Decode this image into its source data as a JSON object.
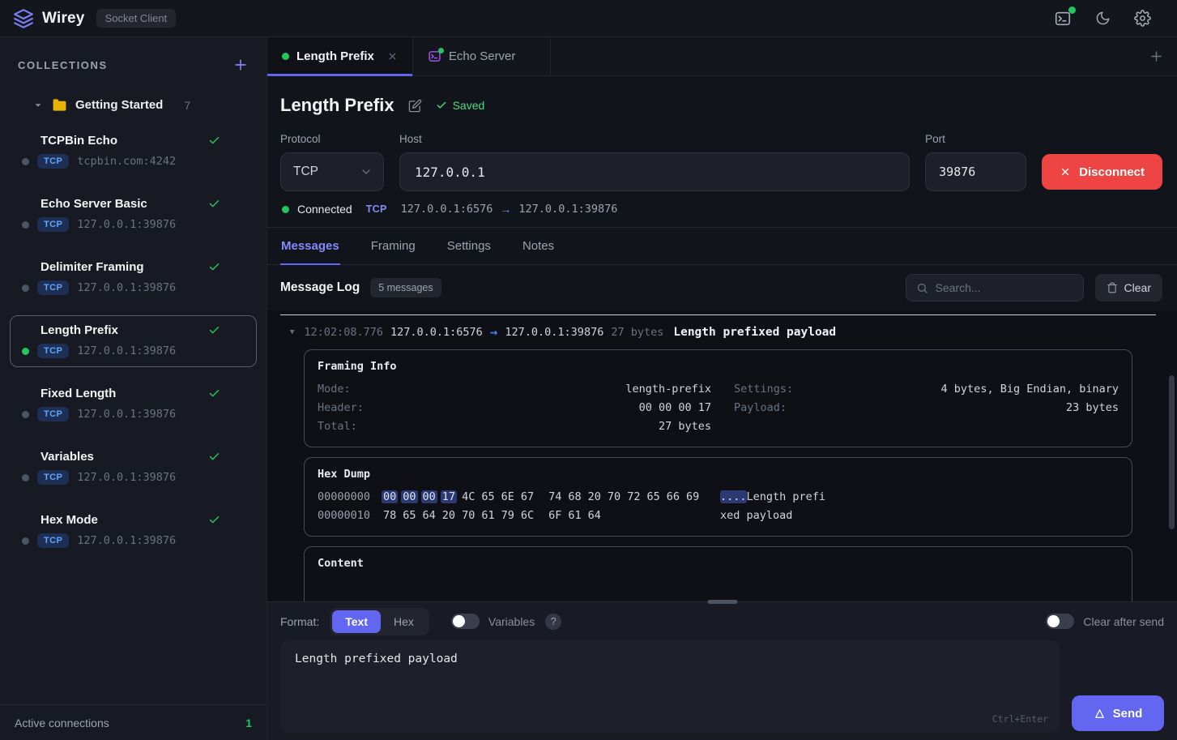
{
  "colors": {
    "accent": "#6366f1",
    "green": "#22c55e",
    "red": "#ef4444",
    "badge_blue": "#60a5fa",
    "purple_light": "#818cf8"
  },
  "topbar": {
    "app_name": "Wirey",
    "app_badge": "Socket Client",
    "icons": [
      "terminal-activity",
      "dark-mode-moon",
      "settings-gear"
    ]
  },
  "sidebar": {
    "title": "COLLECTIONS",
    "folder": {
      "name": "Getting Started",
      "count": "7"
    },
    "items": [
      {
        "name": "TCPBin Echo",
        "protocol": "TCP",
        "address": "tcpbin.com:4242",
        "connected": false,
        "selected": false
      },
      {
        "name": "Echo Server Basic",
        "protocol": "TCP",
        "address": "127.0.0.1:39876",
        "connected": false,
        "selected": false
      },
      {
        "name": "Delimiter Framing",
        "protocol": "TCP",
        "address": "127.0.0.1:39876",
        "connected": false,
        "selected": false
      },
      {
        "name": "Length Prefix",
        "protocol": "TCP",
        "address": "127.0.0.1:39876",
        "connected": true,
        "selected": true
      },
      {
        "name": "Fixed Length",
        "protocol": "TCP",
        "address": "127.0.0.1:39876",
        "connected": false,
        "selected": false
      },
      {
        "name": "Variables",
        "protocol": "TCP",
        "address": "127.0.0.1:39876",
        "connected": false,
        "selected": false
      },
      {
        "name": "Hex Mode",
        "protocol": "TCP",
        "address": "127.0.0.1:39876",
        "connected": false,
        "selected": false
      }
    ],
    "footer": {
      "label": "Active connections",
      "count": "1"
    }
  },
  "editor_tabs": [
    {
      "label": "Length Prefix",
      "active": true,
      "connected": true,
      "closable": true
    },
    {
      "label": "Echo Server",
      "active": false,
      "icon": "terminal",
      "closable": false
    }
  ],
  "connection": {
    "title": "Length Prefix",
    "saved_status": "Saved",
    "protocol_label": "Protocol",
    "protocol_value": "TCP",
    "host_label": "Host",
    "host_value": "127.0.0.1",
    "port_label": "Port",
    "port_value": "39876",
    "disconnect_label": "Disconnect",
    "status": {
      "state": "Connected",
      "protocol": "TCP",
      "local_address": "127.0.0.1:6576",
      "arrow": "→",
      "remote_address": "127.0.0.1:39876"
    }
  },
  "main_tabs": {
    "items": [
      "Messages",
      "Framing",
      "Settings",
      "Notes"
    ],
    "active": "Messages"
  },
  "message_log": {
    "title": "Message Log",
    "count_badge": "5 messages",
    "search_placeholder": "Search...",
    "clear_label": "Clear",
    "entry": {
      "expander": "▼",
      "timestamp": "12:02:08.776",
      "source": "127.0.0.1:6576",
      "arrow": "→",
      "destination": "127.0.0.1:39876",
      "size": "27 bytes",
      "title": "Length prefixed payload",
      "framing_info": {
        "title": "Framing Info",
        "left_rows": [
          {
            "label": "Mode:",
            "value": "length-prefix"
          },
          {
            "label": "Header:",
            "value": "00 00 00 17"
          },
          {
            "label": "Total:",
            "value": "27 bytes"
          }
        ],
        "right_rows": [
          {
            "label": "Settings:",
            "value": "4 bytes, Big Endian, binary"
          },
          {
            "label": "Payload:",
            "value": "23 bytes"
          }
        ]
      },
      "hex_dump": {
        "title": "Hex Dump",
        "rows": [
          {
            "offset": "00000000",
            "group1": [
              "00",
              "00",
              "00",
              "17",
              "4C",
              "65",
              "6E",
              "67"
            ],
            "group2": [
              "74",
              "68",
              "20",
              "70",
              "72",
              "65",
              "66",
              "69"
            ],
            "highlight_count": 4,
            "ascii_highlight": "....",
            "ascii": "Length prefi"
          },
          {
            "offset": "00000010",
            "group1": [
              "78",
              "65",
              "64",
              "20",
              "70",
              "61",
              "79",
              "6C"
            ],
            "group2": [
              "6F",
              "61",
              "64"
            ],
            "highlight_count": 0,
            "ascii_highlight": "",
            "ascii": "xed payload"
          }
        ]
      },
      "content": {
        "title": "Content"
      }
    }
  },
  "composer": {
    "format_label": "Format:",
    "format_options": [
      "Text",
      "Hex"
    ],
    "format_active": "Text",
    "variables_label": "Variables",
    "variables_on": false,
    "help_label": "?",
    "clear_after_send_label": "Clear after send",
    "clear_after_send_on": false,
    "message_value": "Length prefixed payload",
    "shortcut_hint": "Ctrl+Enter",
    "send_label": "Send"
  }
}
